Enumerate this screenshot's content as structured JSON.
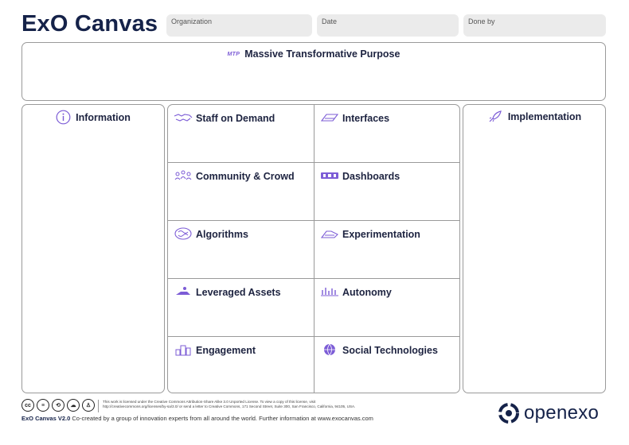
{
  "header": {
    "title": "ExO Canvas",
    "fields": {
      "organization": "Organization",
      "date": "Date",
      "done_by": "Done by"
    }
  },
  "mtp": {
    "badge": "MTP",
    "label": "Massive Transformative Purpose"
  },
  "information": {
    "label": "Information"
  },
  "implementation": {
    "label": "Implementation"
  },
  "scale": [
    {
      "label": "Staff on Demand",
      "icon": "handshake-icon"
    },
    {
      "label": "Community & Crowd",
      "icon": "crowd-icon"
    },
    {
      "label": "Algorithms",
      "icon": "brain-icon"
    },
    {
      "label": "Leveraged Assets",
      "icon": "assets-icon"
    },
    {
      "label": "Engagement",
      "icon": "trophy-icon"
    }
  ],
  "ideas": [
    {
      "label": "Interfaces",
      "icon": "funnel-icon"
    },
    {
      "label": "Dashboards",
      "icon": "dashboard-icon"
    },
    {
      "label": "Experimentation",
      "icon": "lab-icon"
    },
    {
      "label": "Autonomy",
      "icon": "autonomy-icon"
    },
    {
      "label": "Social Technologies",
      "icon": "globe-icon"
    }
  ],
  "footer": {
    "license_line1": "This work is licensed under the Creative Commons Attribution-Share Alike 3.0 Unported License. To view a copy of this license, visit",
    "license_line2": "http://creativecommons.org/licenses/by-sa/3.0/ or send a letter to Creative Commons, 171 Second Street, Suite 300, San Francisco, California, 94105, USA.",
    "credit_title": "ExO Canvas V2.0",
    "credit_text": "Co-created by a group of innovation experts from all around the world. Further information at www.exocanvas.com",
    "brand": "openexo"
  },
  "colors": {
    "accent": "#7c5cd6",
    "navy": "#152249",
    "field": "#ebebeb",
    "border": "#9a9a9a"
  }
}
